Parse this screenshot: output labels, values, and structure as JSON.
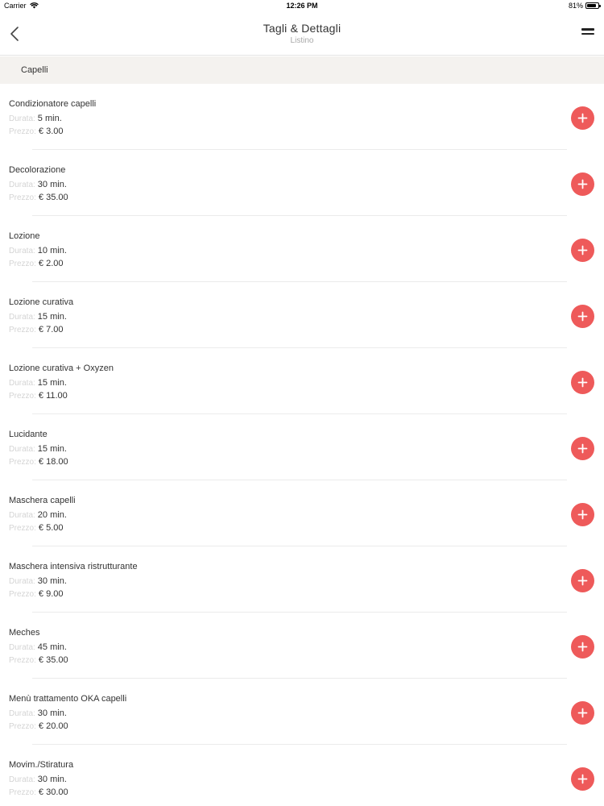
{
  "status_bar": {
    "carrier": "Carrier",
    "time": "12:26 PM",
    "battery": "81%",
    "battery_level": 0.81
  },
  "nav": {
    "title": "Tagli & Dettagli",
    "subtitle": "Listino"
  },
  "section": {
    "title": "Capelli"
  },
  "labels": {
    "duration": "Durata:",
    "price": "Prezzo:"
  },
  "items": [
    {
      "name": "Condizionatore capelli",
      "duration": "5 min.",
      "price": "€ 3.00"
    },
    {
      "name": "Decolorazione",
      "duration": "30 min.",
      "price": "€ 35.00"
    },
    {
      "name": "Lozione",
      "duration": "10 min.",
      "price": "€ 2.00"
    },
    {
      "name": "Lozione curativa",
      "duration": "15 min.",
      "price": "€ 7.00"
    },
    {
      "name": "Lozione curativa + Oxyzen",
      "duration": "15 min.",
      "price": "€ 11.00"
    },
    {
      "name": "Lucidante",
      "duration": "15 min.",
      "price": "€ 18.00"
    },
    {
      "name": "Maschera capelli",
      "duration": "20 min.",
      "price": "€ 5.00"
    },
    {
      "name": "Maschera intensiva ristrutturante",
      "duration": "30 min.",
      "price": "€ 9.00"
    },
    {
      "name": "Meches",
      "duration": "45 min.",
      "price": "€ 35.00"
    },
    {
      "name": "Menù trattamento OKA capelli",
      "duration": "30 min.",
      "price": "€ 20.00"
    },
    {
      "name": "Movim./Stiratura",
      "duration": "30 min.",
      "price": "€ 30.00"
    }
  ],
  "colors": {
    "accent": "#ee5a5a",
    "section_bg": "#f4f2ef",
    "label_gray": "#d4d4d4"
  },
  "icons": {
    "back": "chevron-left-icon",
    "menu": "hamburger-menu-icon",
    "add": "plus-icon"
  }
}
